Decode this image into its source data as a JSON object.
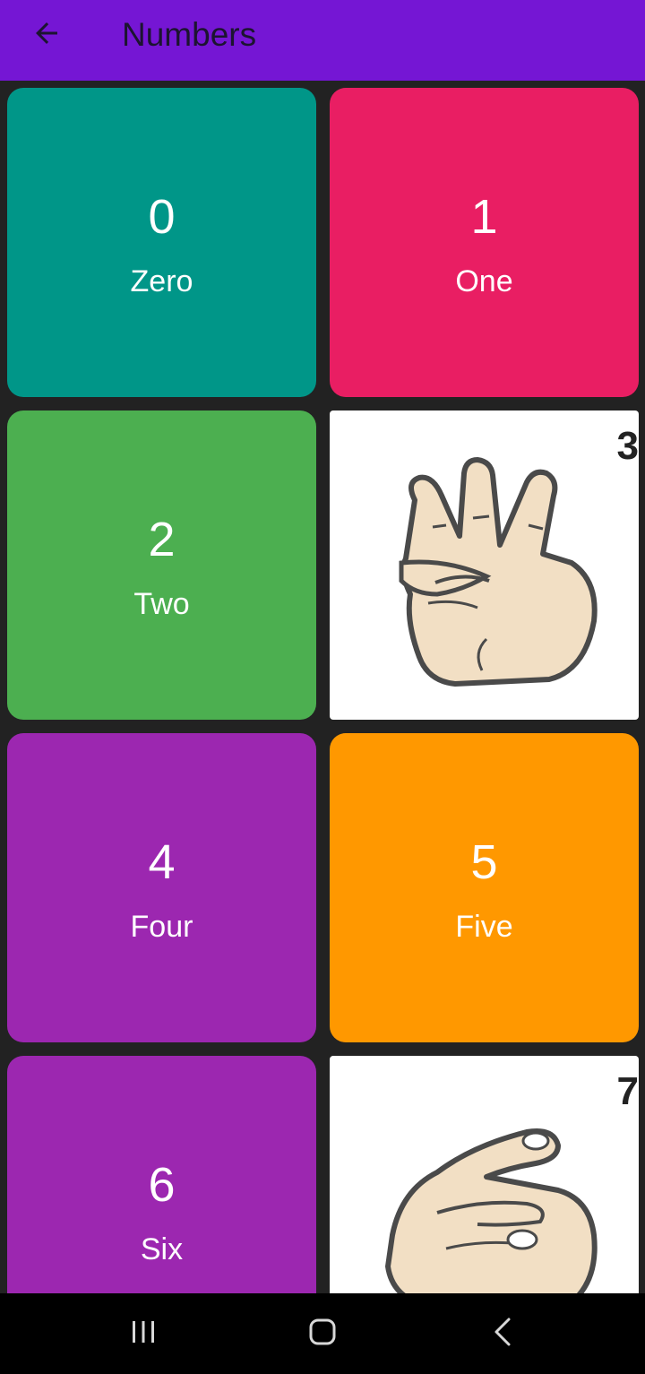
{
  "colors": {
    "app_bar": "#7516d4",
    "background": "#222222",
    "teal": "#009688",
    "pink": "#e91e63",
    "green": "#4caf50",
    "purple": "#9c27b0",
    "orange": "#ff9800"
  },
  "header": {
    "title": "Numbers",
    "back_icon": "arrow-back-icon"
  },
  "cards": [
    {
      "kind": "text",
      "number": "0",
      "word": "Zero",
      "color": "#009688"
    },
    {
      "kind": "text",
      "number": "1",
      "word": "One",
      "color": "#e91e63"
    },
    {
      "kind": "text",
      "number": "2",
      "word": "Two",
      "color": "#4caf50"
    },
    {
      "kind": "image",
      "image": "hand-sign-three",
      "corner_label": "3"
    },
    {
      "kind": "text",
      "number": "4",
      "word": "Four",
      "color": "#9c27b0"
    },
    {
      "kind": "text",
      "number": "5",
      "word": "Five",
      "color": "#ff9800"
    },
    {
      "kind": "text",
      "number": "6",
      "word": "Six",
      "color": "#9c27b0"
    },
    {
      "kind": "image",
      "image": "hand-sign-seven",
      "corner_label": "7"
    }
  ],
  "navigation": {
    "recents_icon": "recent-apps-icon",
    "home_icon": "home-icon",
    "back_icon": "nav-back-icon"
  }
}
